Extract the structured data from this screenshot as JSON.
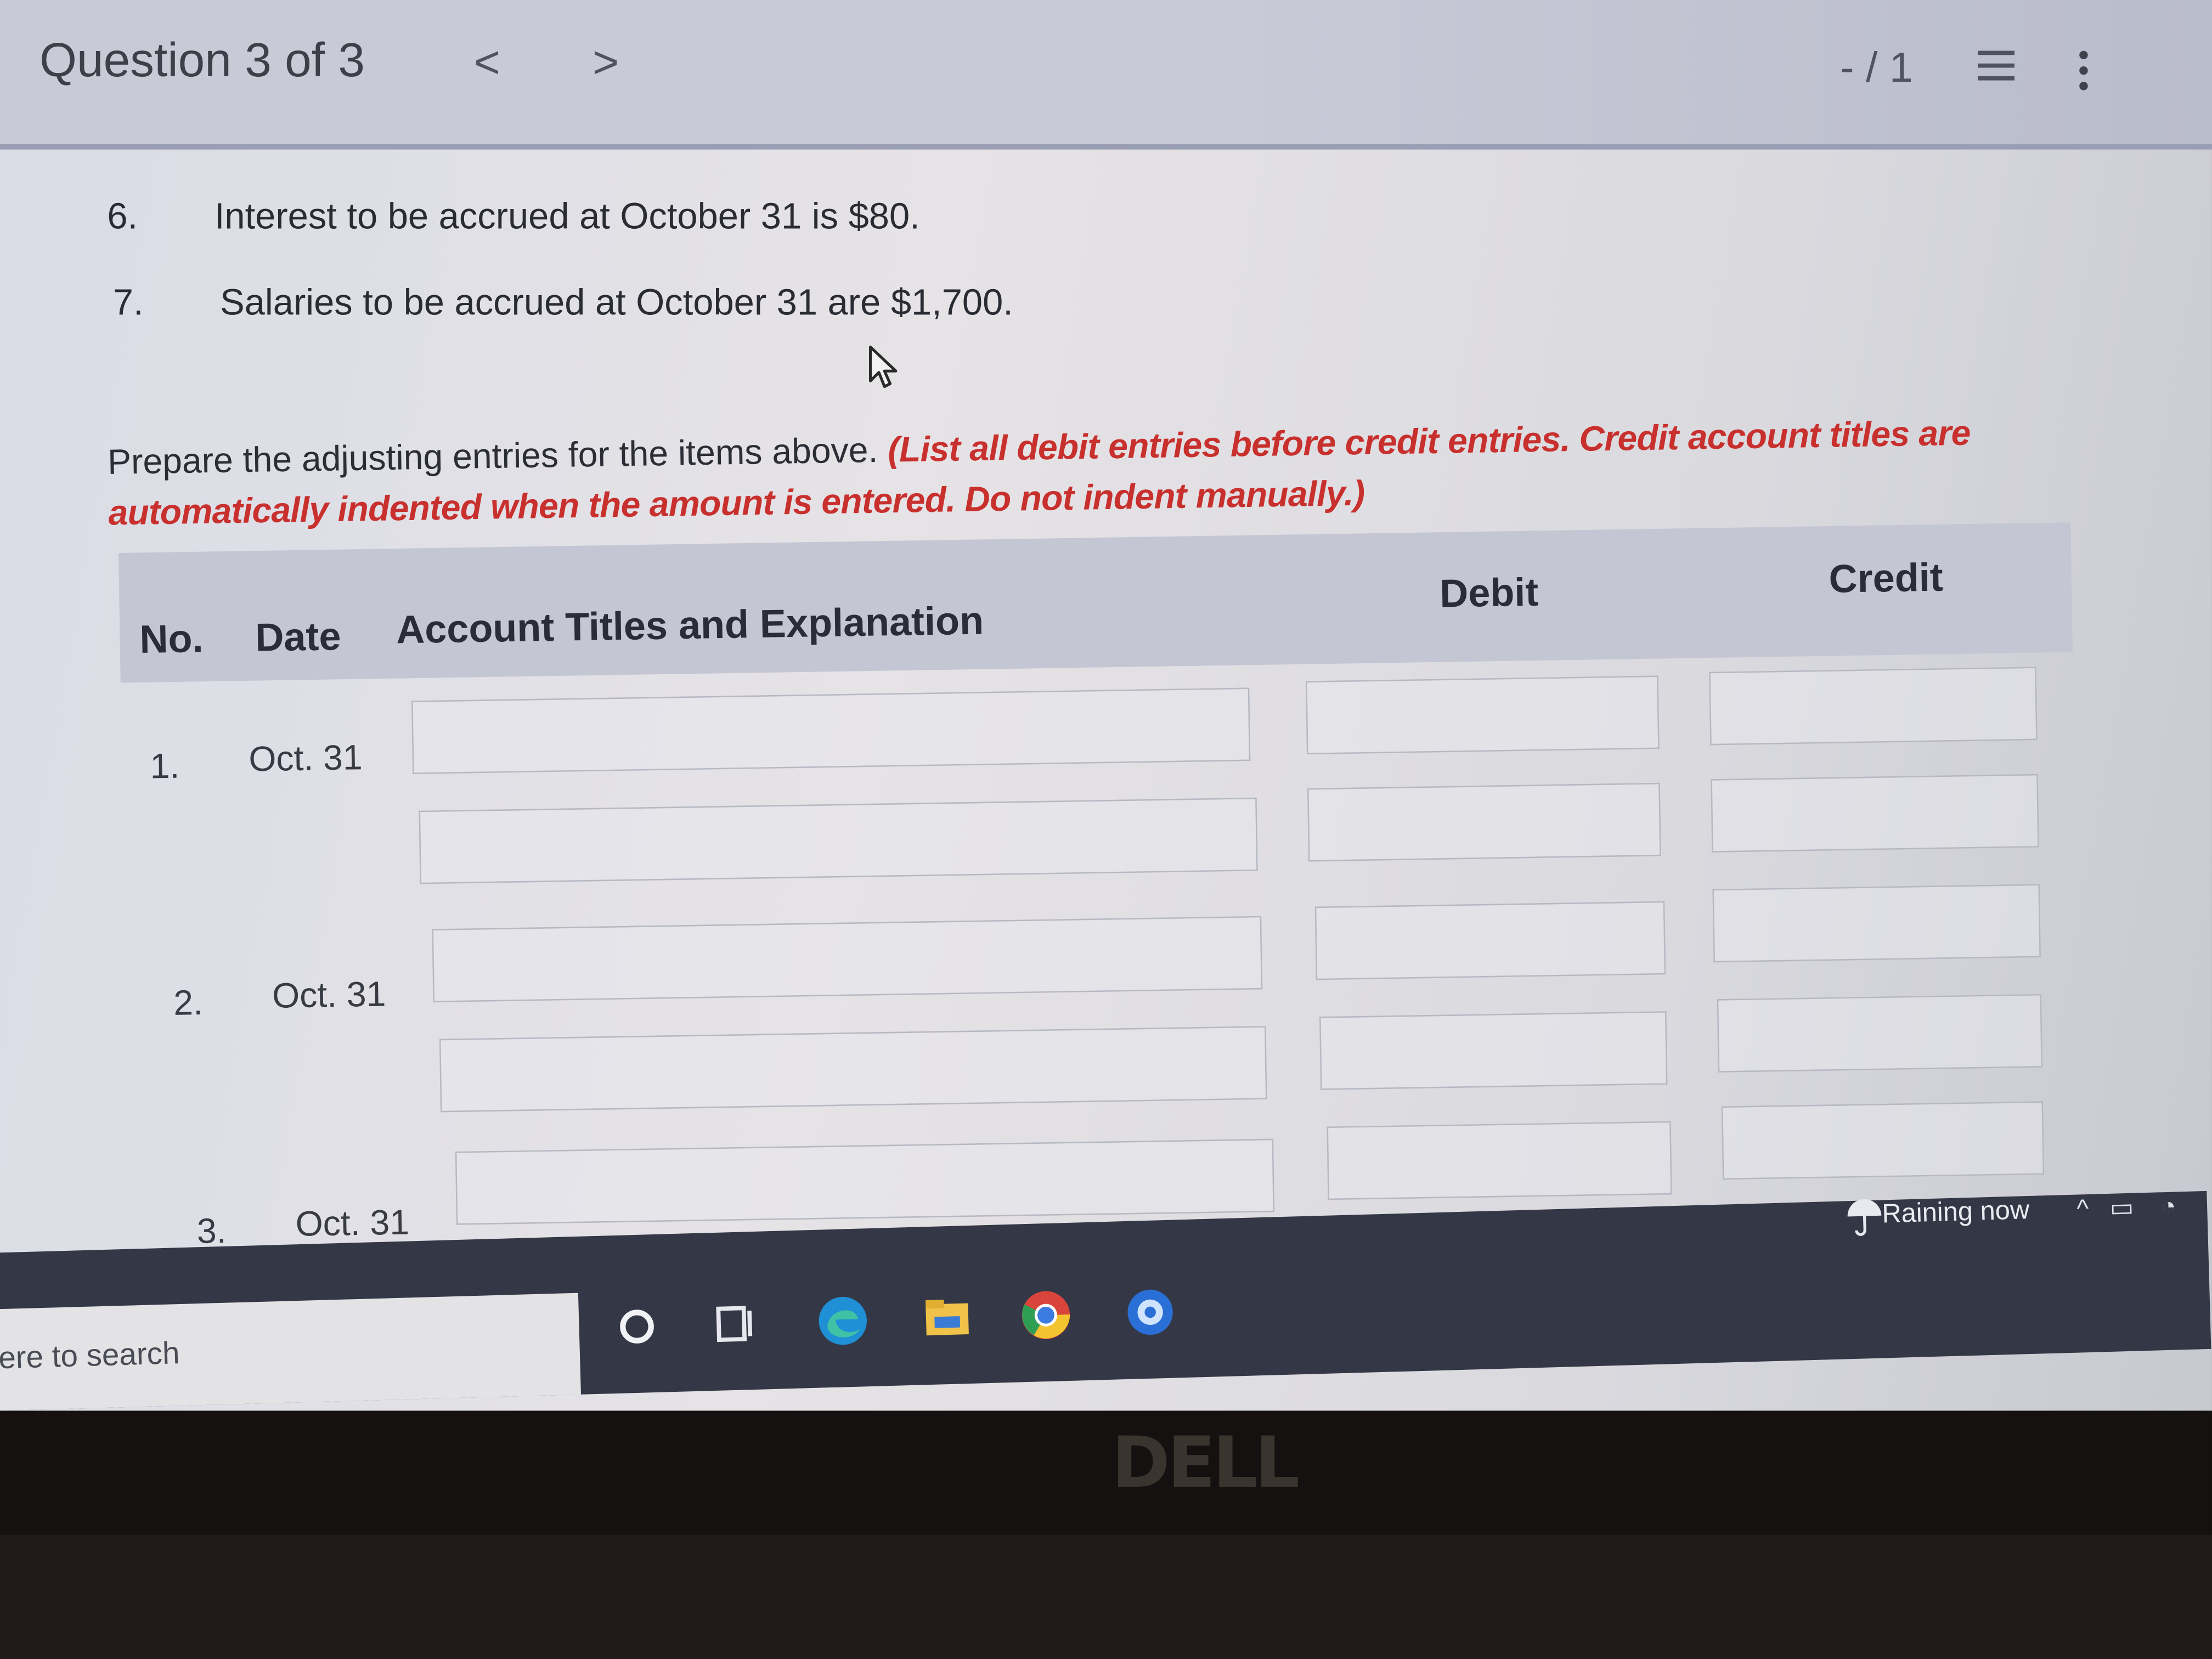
{
  "header": {
    "question_label": "Question 3 of 3",
    "prev_arrow": "<",
    "next_arrow": ">",
    "score": "- / 1"
  },
  "items": [
    {
      "num": "6.",
      "text": "Interest to be accrued at October 31 is $80."
    },
    {
      "num": "7.",
      "text": "Salaries to be accrued at October 31 are $1,700."
    }
  ],
  "prompt": {
    "text": "Prepare the adjusting entries for the items above.",
    "note": "(List all debit entries before credit entries. Credit account titles are automatically indented when the amount is entered. Do not indent manually.)"
  },
  "table": {
    "headers": {
      "no": "No.",
      "date": "Date",
      "account": "Account Titles and Explanation",
      "debit": "Debit",
      "credit": "Credit"
    },
    "entries": [
      {
        "no": "1.",
        "date": "Oct. 31",
        "account_1": "",
        "debit_1": "",
        "credit_1": "",
        "account_2": "",
        "debit_2": "",
        "credit_2": ""
      },
      {
        "no": "2.",
        "date": "Oct. 31",
        "account_1": "",
        "debit_1": "",
        "credit_1": "",
        "account_2": "",
        "debit_2": "",
        "credit_2": ""
      },
      {
        "no": "3.",
        "date": "Oct. 31",
        "account_1": "",
        "debit_1": "",
        "credit_1": ""
      }
    ]
  },
  "taskbar": {
    "search_placeholder": "ere to search",
    "weather": "Raining now",
    "icons": [
      "cortana-circle-icon",
      "task-view-icon",
      "edge-icon",
      "file-explorer-icon",
      "chrome-icon",
      "app-icon"
    ]
  },
  "bezel": {
    "brand": "DELL"
  },
  "colors": {
    "instruction_red": "#c8302e",
    "header_bg": "#c4c6d3",
    "taskbar_bg": "#343846"
  }
}
